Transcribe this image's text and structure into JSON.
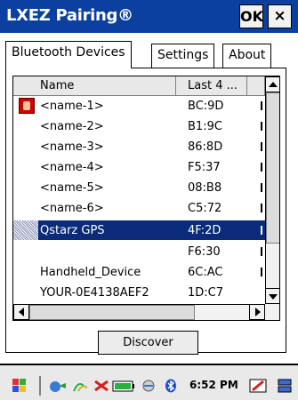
{
  "window": {
    "title": "LXEZ Pairing®",
    "ok_label": "OK",
    "close_label": "×"
  },
  "tabs": [
    {
      "label": "Bluetooth Devices",
      "active": true
    },
    {
      "label": "Settings",
      "active": false
    },
    {
      "label": "About",
      "active": false
    }
  ],
  "list": {
    "columns": [
      "Name",
      "Last 4 ...",
      ""
    ],
    "rows": [
      {
        "name": "<name-1>",
        "last4": "BC:9D",
        "icon": "paired-device-icon"
      },
      {
        "name": "<name-2>",
        "last4": "B1:9C"
      },
      {
        "name": "<name-3>",
        "last4": "86:8D"
      },
      {
        "name": "<name-4>",
        "last4": "F5:37"
      },
      {
        "name": "<name-5>",
        "last4": "08:B8"
      },
      {
        "name": "<name-6>",
        "last4": "C5:72"
      },
      {
        "name": "Qstarz GPS",
        "last4": "4F:2D",
        "selected": true
      },
      {
        "name": "",
        "last4": "F6:30"
      },
      {
        "name": "Handheld_Device",
        "last4": "6C:AC"
      },
      {
        "name": "YOUR-0E4138AEF2",
        "last4": "1D:C7"
      }
    ]
  },
  "discover_label": "Discover",
  "taskbar": {
    "time": "6:52 PM"
  },
  "colors": {
    "titlebar": "#0b3fa0",
    "selection": "#0a2a7a"
  }
}
